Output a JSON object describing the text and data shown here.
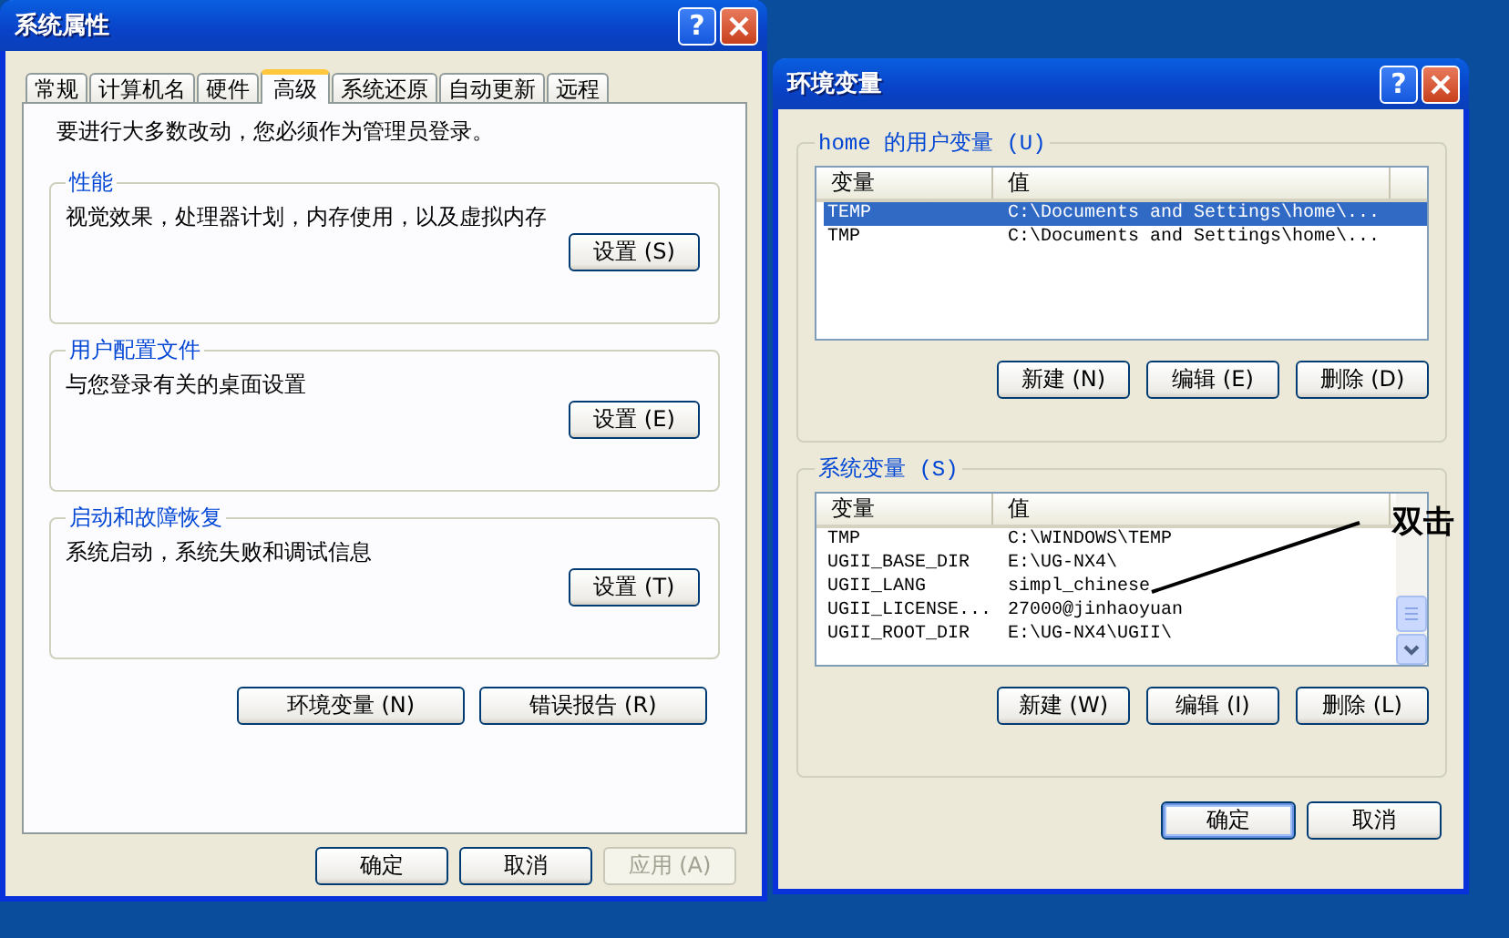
{
  "system_properties": {
    "title": "系统属性",
    "help": "?",
    "tabs": [
      {
        "label": "常规",
        "selected": false
      },
      {
        "label": "计算机名",
        "selected": false
      },
      {
        "label": "硬件",
        "selected": false
      },
      {
        "label": "高级",
        "selected": true
      },
      {
        "label": "系统还原",
        "selected": false
      },
      {
        "label": "自动更新",
        "selected": false
      },
      {
        "label": "远程",
        "selected": false
      }
    ],
    "notice": "要进行大多数改动，您必须作为管理员登录。",
    "groups": [
      {
        "title": "性能",
        "description": "视觉效果，处理器计划，内存使用，以及虚拟内存",
        "button": "设置 (S)"
      },
      {
        "title": "用户配置文件",
        "description": "与您登录有关的桌面设置",
        "button": "设置 (E)"
      },
      {
        "title": "启动和故障恢复",
        "description": "系统启动，系统失败和调试信息",
        "button": "设置 (T)"
      }
    ],
    "panel_buttons": [
      "环境变量 (N)",
      "错误报告 (R)"
    ],
    "buttons": [
      {
        "label": "确定",
        "disabled": false
      },
      {
        "label": "取消",
        "disabled": false
      },
      {
        "label": "应用 (A)",
        "disabled": true
      }
    ]
  },
  "environment_variables": {
    "title": "环境变量",
    "help": "?",
    "user_group": {
      "title": "home 的用户变量 (U)",
      "columns": [
        "变量",
        "值"
      ],
      "rows": [
        {
          "name": "TEMP",
          "value": "C:\\Documents and Settings\\home\\...",
          "selected": true
        },
        {
          "name": "TMP",
          "value": "C:\\Documents and Settings\\home\\...",
          "selected": false
        }
      ],
      "buttons": [
        "新建 (N)",
        "编辑 (E)",
        "删除 (D)"
      ]
    },
    "system_group": {
      "title": "系统变量 (S)",
      "columns": [
        "变量",
        "值"
      ],
      "rows": [
        {
          "name": "TMP",
          "value": "C:\\WINDOWS\\TEMP",
          "selected": false
        },
        {
          "name": "UGII_BASE_DIR",
          "value": "E:\\UG-NX4\\",
          "selected": false
        },
        {
          "name": "UGII_LANG",
          "value": "simpl_chinese",
          "selected": false
        },
        {
          "name": "UGII_LICENSE...",
          "value": "27000@jinhaoyuan",
          "selected": false
        },
        {
          "name": "UGII_ROOT_DIR",
          "value": "E:\\UG-NX4\\UGII\\",
          "selected": false
        }
      ],
      "buttons": [
        "新建 (W)",
        "编辑 (I)",
        "删除 (L)"
      ]
    },
    "buttons": [
      {
        "label": "确定",
        "default": true
      },
      {
        "label": "取消",
        "default": false
      }
    ]
  },
  "annotation": {
    "text": "双击"
  }
}
